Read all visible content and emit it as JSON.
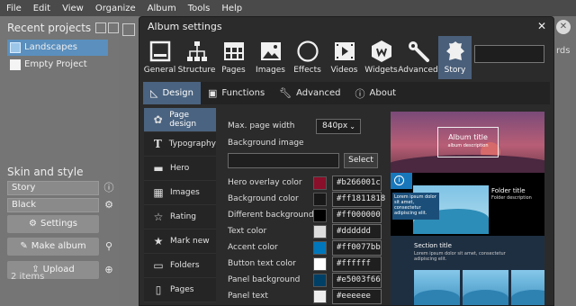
{
  "menu": [
    "File",
    "Edit",
    "View",
    "Organize",
    "Album",
    "Tools",
    "Help"
  ],
  "left": {
    "recent_title": "Recent projects",
    "projects": [
      {
        "name": "Landscapes",
        "selected": true
      },
      {
        "name": "Empty Project",
        "selected": false
      }
    ],
    "skin_title": "Skin and style",
    "skin": "Story",
    "style": "Black",
    "settings_label": "Settings",
    "make_album_label": "Make album",
    "upload_label": "Upload",
    "items_count": "2 items"
  },
  "right_strip": {
    "partial_text": "rds"
  },
  "dialog": {
    "title": "Album settings",
    "close_glyph": "✕",
    "toolbar": [
      {
        "label": "General",
        "icon": "general-icon"
      },
      {
        "label": "Structure",
        "icon": "structure-icon"
      },
      {
        "label": "Pages",
        "icon": "pages-icon"
      },
      {
        "label": "Images",
        "icon": "images-icon"
      },
      {
        "label": "Effects",
        "icon": "effects-icon"
      },
      {
        "label": "Videos",
        "icon": "videos-icon"
      },
      {
        "label": "Widgets",
        "icon": "widgets-icon"
      },
      {
        "label": "Advanced",
        "icon": "advanced-icon"
      },
      {
        "label": "Story",
        "icon": "story-icon",
        "active": true
      }
    ],
    "tabs": [
      {
        "label": "Design",
        "icon": "design-icon",
        "active": true
      },
      {
        "label": "Functions",
        "icon": "functions-icon"
      },
      {
        "label": "Advanced",
        "icon": "wrench-icon"
      },
      {
        "label": "About",
        "icon": "info-icon"
      }
    ],
    "subnav": [
      {
        "label": "Page design",
        "icon": "palette-icon",
        "active": true
      },
      {
        "label": "Typography",
        "icon": "typography-icon"
      },
      {
        "label": "Hero",
        "icon": "hero-icon"
      },
      {
        "label": "Images",
        "icon": "grid-icon"
      },
      {
        "label": "Rating",
        "icon": "star-outline-icon"
      },
      {
        "label": "Mark new",
        "icon": "star-icon"
      },
      {
        "label": "Folders",
        "icon": "folder-icon"
      },
      {
        "label": "Pages",
        "icon": "page-icon"
      }
    ],
    "settings": {
      "max_width_label": "Max. page width",
      "max_width_value": "840px",
      "bg_image_label": "Background image",
      "bg_image_value": "",
      "select_label": "Select",
      "colors": [
        {
          "label": "Hero overlay color",
          "value": "#b266001c",
          "swatch": "#8a0f2a"
        },
        {
          "label": "Background color",
          "value": "#ff1811818",
          "swatch": "#181818"
        },
        {
          "label": "Different background",
          "value": "#ff000000",
          "swatch": "#000000"
        },
        {
          "label": "Text color",
          "value": "#dddddd",
          "swatch": "#dddddd"
        },
        {
          "label": "Accent color",
          "value": "#ff0077bb",
          "swatch": "#0077bb"
        },
        {
          "label": "Button text color",
          "value": "#ffffff",
          "swatch": "#ffffff"
        },
        {
          "label": "Panel background",
          "value": "#e5003f66",
          "swatch": "#003f66"
        },
        {
          "label": "Panel text",
          "value": "#eeeeee",
          "swatch": "#eeeeee"
        }
      ]
    },
    "preview": {
      "album_title": "Album title",
      "album_desc": "album description",
      "folder_title": "Folder title",
      "folder_desc": "Folder description",
      "caption": "Lorem ipsum dolor sit amet, consectetur adipiscing elit.",
      "section_title": "Section title",
      "section_desc": "Lorem ipsum dolor sit amet, consectetur adipiscing elit."
    }
  },
  "colors": {
    "accent": "#4a6380",
    "selection": "#5a8fbe"
  }
}
